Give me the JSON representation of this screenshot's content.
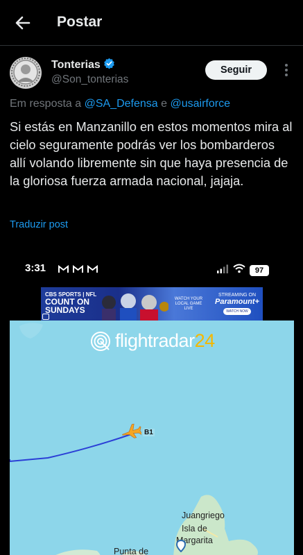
{
  "header": {
    "title": "Postar"
  },
  "author": {
    "name": "Tonterias",
    "handle": "@Son_tonterias",
    "follow_label": "Seguir"
  },
  "reply": {
    "prefix": "Em resposta a",
    "mention1": "@SA_Defensa",
    "conj": "e",
    "mention2": "@usairforce"
  },
  "tweet": {
    "text": "Si estás en Manzanillo en estos momentos mira al cielo seguramente podrás ver los bombarderos allí volando libremente sin que haya presencia de la gloriosa fuerza armada nacional, jajaja.",
    "translate_label": "Traduzir post"
  },
  "media": {
    "status_time": "3:31",
    "battery": "97",
    "ad": {
      "brand": "CBS SPORTS | NFL",
      "headline1": "COUNT ON",
      "headline2": "SUNDAYS",
      "mid_text": "WATCH YOUR LOCAL GAME LIVE",
      "streaming_label": "STREAMING ON",
      "paramount": "Paramount+",
      "watch_now": "WATCH NOW"
    },
    "map": {
      "logo_main": "flightradar",
      "logo_num": "24",
      "callsign": "B1",
      "places": [
        "Juangriego",
        "Isla de",
        "Margarita",
        "Punta de"
      ]
    }
  },
  "colors": {
    "accent": "#1d9bf0",
    "background": "#000000",
    "map_sea": "#8dd6ea",
    "flight_path": "#2b3fd6",
    "plane": "#f5a623"
  }
}
